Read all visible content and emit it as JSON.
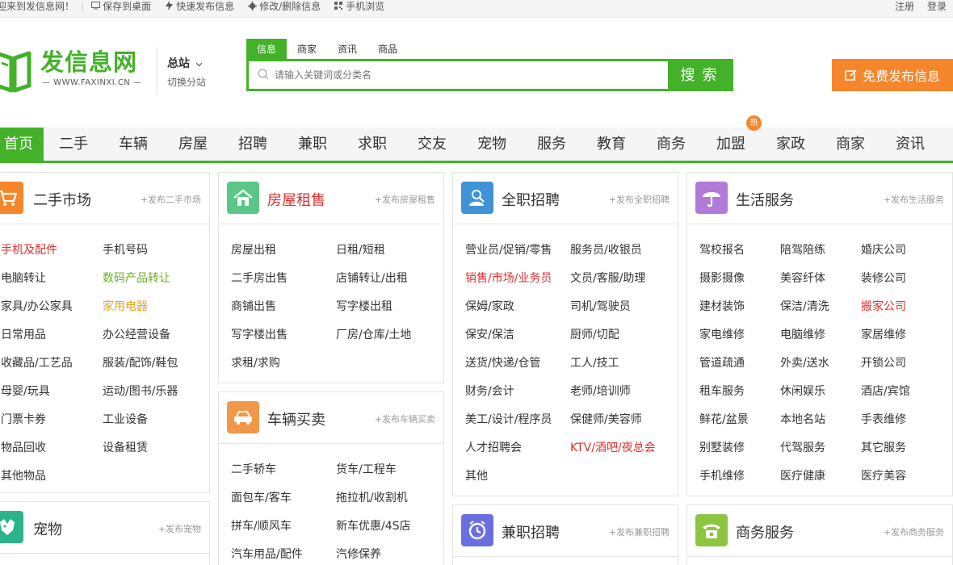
{
  "topbar": {
    "welcome": "迎来到发信息网！",
    "save_desktop": "保存到桌面",
    "quick_post": "快速发布信息",
    "edit_delete": "修改/删除信息",
    "mobile": "手机浏览",
    "register": "注册",
    "login": "登录"
  },
  "header": {
    "logo_text": "发信息网",
    "logo_sub": "WWW.FAXINXI.CN",
    "city": "总站",
    "city_switch": "切换分站",
    "publish_label": "免费发布信息"
  },
  "search": {
    "tabs": [
      "信息",
      "商家",
      "资讯",
      "商品"
    ],
    "placeholder": "请输入关键词或分类名",
    "button": "搜 索"
  },
  "nav": {
    "items": [
      "首页",
      "二手",
      "车辆",
      "房屋",
      "招聘",
      "兼职",
      "求职",
      "交友",
      "宠物",
      "服务",
      "教育",
      "商务",
      "加盟",
      "家政",
      "商家",
      "资讯"
    ],
    "hot_badge": "热"
  },
  "cards": {
    "secondhand": {
      "title": "二手市场",
      "pub": "+发布二手市场",
      "links": [
        "手机及配件",
        "手机号码",
        "电脑转让",
        "数码产品转让",
        "家具/办公家具",
        "家用电器",
        "日常用品",
        "办公经营设备",
        "收藏品/工艺品",
        "服装/配饰/鞋包",
        "母婴/玩具",
        "运动/图书/乐器",
        "门票卡券",
        "工业设备",
        "物品回收",
        "设备租赁",
        "其他物品"
      ]
    },
    "house": {
      "title": "房屋租售",
      "pub": "+发布房屋租售",
      "links": [
        "房屋出租",
        "日租/短租",
        "二手房出售",
        "店铺转让/出租",
        "商铺出售",
        "写字楼出租",
        "写字楼出售",
        "厂房/仓库/土地",
        "求租/求购"
      ]
    },
    "car": {
      "title": "车辆买卖",
      "pub": "+发布车辆买卖",
      "links": [
        "二手轿车",
        "货车/工程车",
        "面包车/客车",
        "拖拉机/收割机",
        "拼车/顺风车",
        "新车优惠/4S店",
        "汽车用品/配件",
        "汽修保养"
      ]
    },
    "job": {
      "title": "全职招聘",
      "pub": "+发布全职招聘",
      "links": [
        "营业员/促销/零售",
        "服务员/收银员",
        "销售/市场/业务员",
        "文员/客服/助理",
        "保姆/家政",
        "司机/驾驶员",
        "保安/保洁",
        "厨师/切配",
        "送货/快递/仓管",
        "工人/技工",
        "财务/会计",
        "老师/培训师",
        "美工/设计/程序员",
        "保健师/美容师",
        "人才招聘会",
        "KTV/酒吧/夜总会",
        "其他"
      ]
    },
    "parttime": {
      "title": "兼职招聘",
      "pub": "+发布兼职招聘"
    },
    "life": {
      "title": "生活服务",
      "pub": "+发布生活服务",
      "links": [
        "驾校报名",
        "陪驾陪练",
        "婚庆公司",
        "摄影摄像",
        "美容纤体",
        "装修公司",
        "建材装饰",
        "保洁/清洗",
        "搬家公司",
        "家电维修",
        "电脑维修",
        "家居维修",
        "管道疏通",
        "外卖/送水",
        "开锁公司",
        "租车服务",
        "休闲娱乐",
        "酒店/宾馆",
        "鲜花/盆景",
        "本地名站",
        "手表维修",
        "别墅装修",
        "代驾服务",
        "其它服务",
        "手机维修",
        "医疗健康",
        "医疗美容"
      ]
    },
    "business": {
      "title": "商务服务",
      "pub": "+发布商务服务"
    },
    "pet": {
      "title": "宠物",
      "pub": "+发布宠物"
    }
  },
  "colors": {
    "brand_green": "#43b229",
    "publish_orange": "#f5862b",
    "highlight_red": "#e03030"
  }
}
